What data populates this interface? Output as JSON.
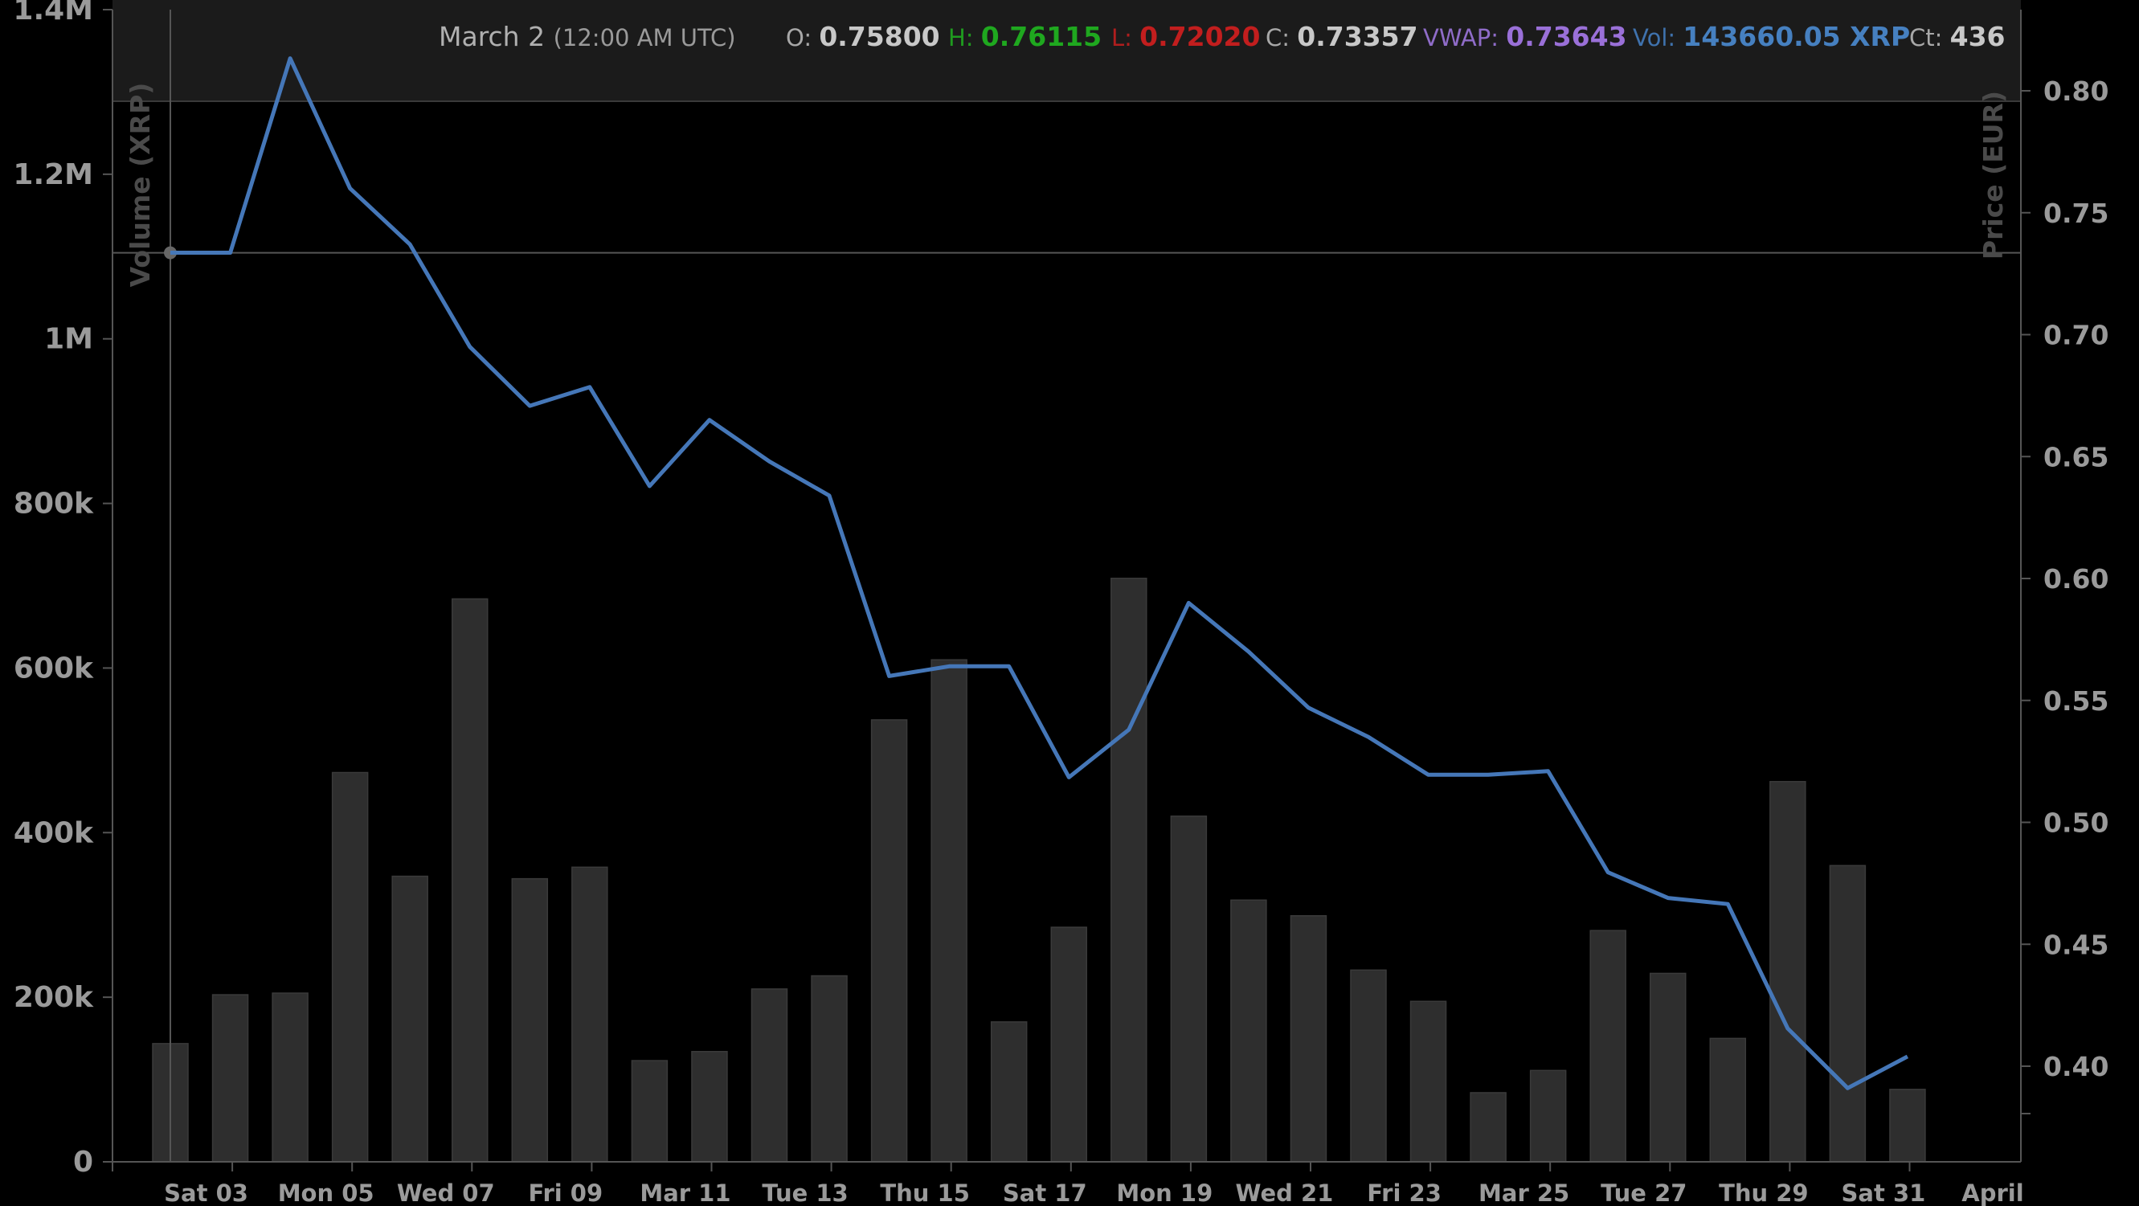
{
  "chart_data": {
    "type": "bar",
    "secondary_type": "line",
    "x_axis": {
      "tick_labels": [
        "Sat 03",
        "Mon 05",
        "Wed 07",
        "Fri 09",
        "Mar 11",
        "Tue 13",
        "Thu 15",
        "Sat 17",
        "Mon 19",
        "Wed 21",
        "Fri 23",
        "Mar 25",
        "Tue 27",
        "Thu 29",
        "Sat 31",
        "April"
      ]
    },
    "left_axis": {
      "title": "Volume (XRP)",
      "ylim": [
        0,
        1400000
      ],
      "tick_values": [
        0,
        200000,
        400000,
        600000,
        800000,
        1000000,
        1200000,
        1400000
      ],
      "tick_labels": [
        "0",
        "200k",
        "400k",
        "600k",
        "800k",
        "1M",
        "1.2M",
        "1.4M"
      ]
    },
    "right_axis": {
      "title": "Price (EUR)",
      "ylim": [
        0.36,
        0.82
      ],
      "tick_values": [
        0.4,
        0.45,
        0.5,
        0.55,
        0.6,
        0.65,
        0.7,
        0.75,
        0.8
      ],
      "tick_labels": [
        "0.40",
        "0.45",
        "0.50",
        "0.55",
        "0.60",
        "0.65",
        "0.70",
        "0.75",
        "0.80"
      ]
    },
    "dates": [
      "2018-03-02",
      "2018-03-03",
      "2018-03-04",
      "2018-03-05",
      "2018-03-06",
      "2018-03-07",
      "2018-03-08",
      "2018-03-09",
      "2018-03-10",
      "2018-03-11",
      "2018-03-12",
      "2018-03-13",
      "2018-03-14",
      "2018-03-15",
      "2018-03-16",
      "2018-03-17",
      "2018-03-18",
      "2018-03-19",
      "2018-03-20",
      "2018-03-21",
      "2018-03-22",
      "2018-03-23",
      "2018-03-24",
      "2018-03-25",
      "2018-03-26",
      "2018-03-27",
      "2018-03-28",
      "2018-03-29",
      "2018-03-30",
      "2018-03-31"
    ],
    "series": [
      {
        "axis": "left",
        "kind": "bar",
        "color": "#2e2e2e",
        "values": [
          143660,
          203000,
          205000,
          473000,
          347000,
          684000,
          344000,
          358000,
          123000,
          134000,
          210000,
          226000,
          537000,
          610000,
          170000,
          285000,
          709000,
          420000,
          318000,
          299000,
          233000,
          195000,
          84000,
          111000,
          281000,
          229000,
          150000,
          462000,
          360000,
          88000
        ]
      },
      {
        "axis": "right",
        "kind": "line",
        "color": "#4577b8",
        "values": [
          0.7336,
          0.7336,
          0.8133,
          0.76,
          0.737,
          0.695,
          0.6708,
          0.6785,
          0.6379,
          0.665,
          0.648,
          0.634,
          0.56,
          0.564,
          0.564,
          0.5185,
          0.538,
          0.59,
          0.57,
          0.547,
          0.535,
          0.5195,
          0.5195,
          0.521,
          0.4795,
          0.469,
          0.4665,
          0.4155,
          0.391,
          0.404
        ]
      }
    ],
    "crosshair": {
      "date": "2018-03-02",
      "price": 0.73357
    },
    "info_bar": {
      "date": "March 2",
      "time": "(12:00 AM UTC)",
      "items": [
        {
          "label": "O:",
          "value": "0.75800",
          "label_color": "#a8a8a8",
          "value_color": "#c8c8c8"
        },
        {
          "label": "H:",
          "value": "0.76115",
          "label_color": "#1f9a1f",
          "value_color": "#1fa81f"
        },
        {
          "label": "L:",
          "value": "0.72020",
          "label_color": "#b01e1e",
          "value_color": "#c21e1e"
        },
        {
          "label": "C:",
          "value": "0.73357",
          "label_color": "#a8a8a8",
          "value_color": "#c8c8c8"
        },
        {
          "label": "VWAP:",
          "value": "0.73643",
          "label_color": "#8f6cc8",
          "value_color": "#9a70d8"
        },
        {
          "label": "Vol:",
          "value": "143660.05 XRP",
          "label_color": "#3f72ad",
          "value_color": "#4680c0"
        },
        {
          "label": "Ct:",
          "value": "436",
          "label_color": "#a8a8a8",
          "value_color": "#c8c8c8"
        }
      ]
    },
    "colors": {
      "background": "#000000",
      "info_bar": "#1b1b1b",
      "bar": "#2e2e2e",
      "line": "#4577b8",
      "axis": "#555555",
      "tick_text": "#9a9a9a",
      "axis_title": "#4a4a4a"
    }
  }
}
